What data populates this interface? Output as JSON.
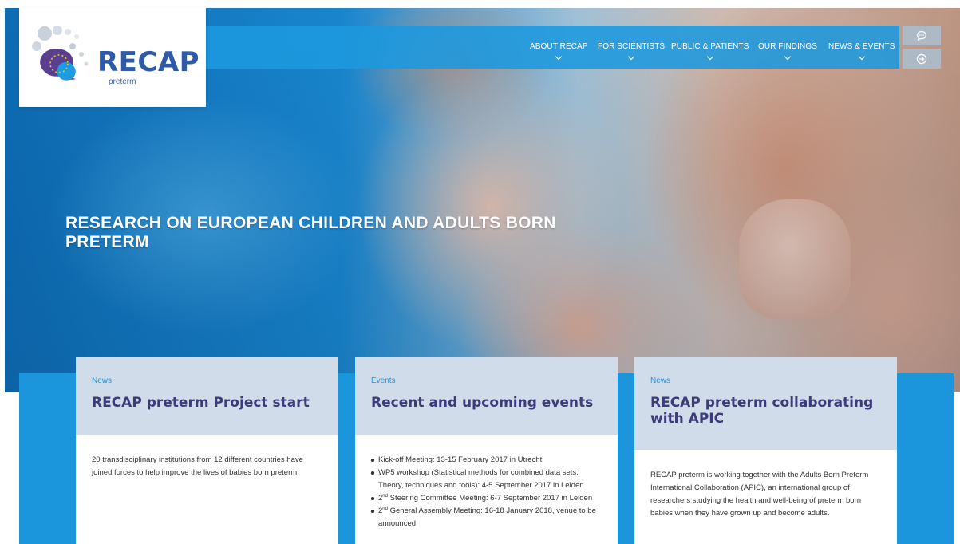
{
  "brand": {
    "logo_word": "RECAP",
    "logo_sub": "preterm"
  },
  "nav": {
    "items": [
      {
        "label": "ABOUT RECAP"
      },
      {
        "label": "FOR SCIENTISTS"
      },
      {
        "label": "PUBLIC & PATIENTS"
      },
      {
        "label": "OUR FINDINGS"
      },
      {
        "label": "NEWS & EVENTS"
      }
    ],
    "side_buttons": [
      {
        "icon": "chat-bubble-icon"
      },
      {
        "icon": "login-arrow-icon"
      }
    ]
  },
  "hero": {
    "title": "RESEARCH ON EUROPEAN CHILDREN AND ADULTS BORN PRETERM"
  },
  "cards": [
    {
      "category": "News",
      "title": "RECAP preterm Project start",
      "body": "20 transdisciplinary institutions from 12 different countries have joined forces to help improve the lives of babies born preterm."
    },
    {
      "category": "Events",
      "title": "Recent and upcoming events",
      "events": [
        {
          "text": "Kick-off Meeting: 13-15 February 2017 in Utrecht"
        },
        {
          "text": "WP5 workshop (Statistical methods for combined data sets: Theory, techniques and tools): 4-5 September 2017 in Leiden"
        },
        {
          "prefix": "2",
          "sup": "nd",
          "text": " Steering Committee Meeting: 6-7 September 2017 in Leiden"
        },
        {
          "prefix": "2",
          "sup": "nd",
          "text": " General Assembly Meeting: 16-18 January 2018, venue to be announced"
        }
      ]
    },
    {
      "category": "News",
      "title": "RECAP preterm collaborating with APIC",
      "body": "RECAP preterm is working together with the Adults Born Preterm International Collaboration (APIC), an international group of researchers studying the health and well-being of preterm born babies when they have grown up and become adults."
    }
  ],
  "colors": {
    "nav_blue": "#1d99de",
    "band_blue": "#1b95dc",
    "card_head": "#d0dce9",
    "title_purple": "#3d3b7c",
    "category_blue": "#2693d5",
    "logo_blue": "#2e5aa8"
  }
}
